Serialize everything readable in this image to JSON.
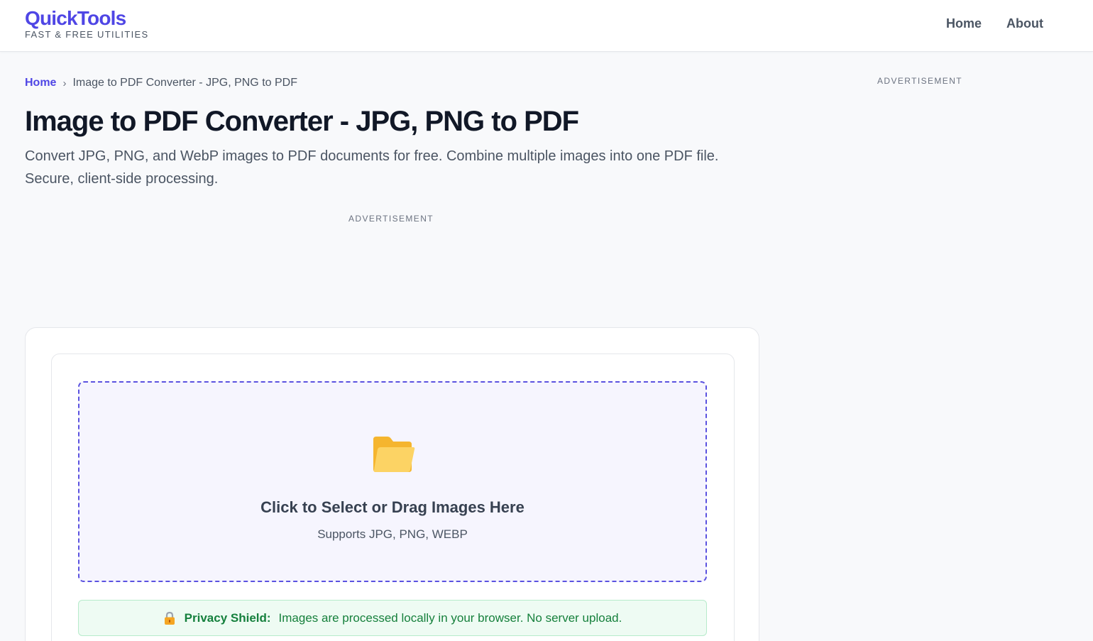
{
  "header": {
    "logo_title": "QuickTools",
    "logo_tagline": "FAST & FREE UTILITIES",
    "nav": [
      {
        "label": "Home"
      },
      {
        "label": "About"
      }
    ]
  },
  "breadcrumb": {
    "home": "Home",
    "separator": "›",
    "current": "Image to PDF Converter - JPG, PNG to PDF"
  },
  "page": {
    "title": "Image to PDF Converter - JPG, PNG to PDF",
    "description": "Convert JPG, PNG, and WebP images to PDF documents for free. Combine multiple images into one PDF file. Secure, client-side processing."
  },
  "ads": {
    "main_label": "ADVERTISEMENT",
    "side_label": "ADVERTISEMENT"
  },
  "dropzone": {
    "icon": "folder-icon",
    "title": "Click to Select or Drag Images Here",
    "subtitle": "Supports JPG, PNG, WEBP"
  },
  "privacy": {
    "icon": "lock-icon",
    "label": "Privacy Shield:",
    "text": "Images are processed locally in your browser. No server upload."
  },
  "colors": {
    "brand": "#4f46e5",
    "dropzone_border": "#5b52e0",
    "privacy_green": "#15803d",
    "folder_yellow": "#fbbf24"
  }
}
